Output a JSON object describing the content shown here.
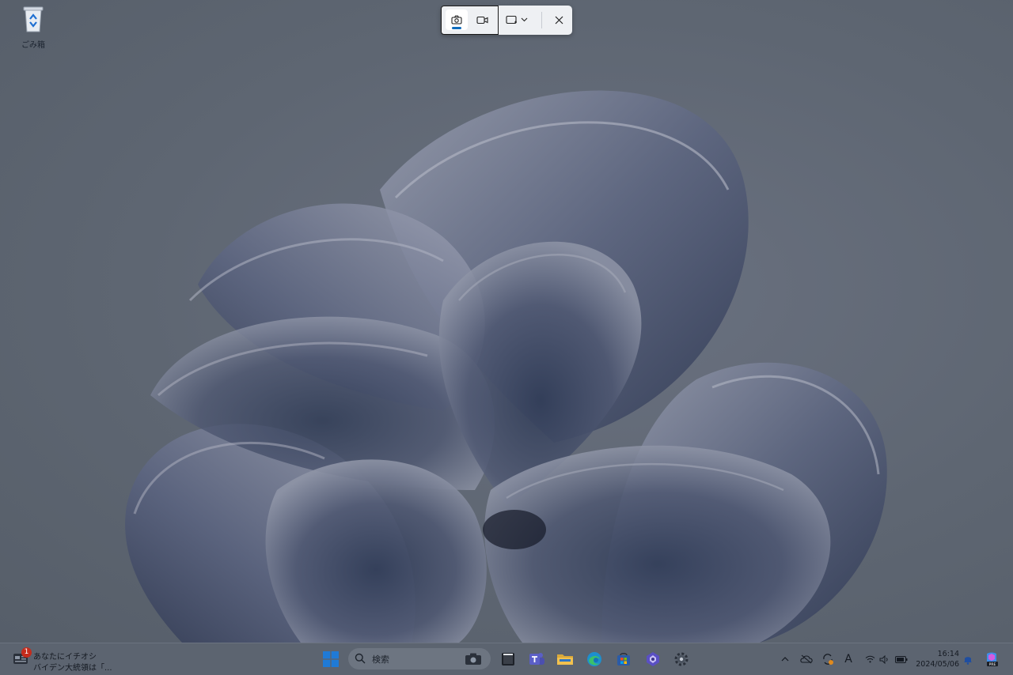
{
  "desktop": {
    "icons": [
      {
        "label": "ごみ箱",
        "icon": "recycle-bin-icon"
      }
    ]
  },
  "snipping_toolbar": {
    "buttons": [
      {
        "name": "screenshot-mode",
        "icon": "camera-icon",
        "selected": true
      },
      {
        "name": "record-mode",
        "icon": "video-camera-icon",
        "selected": false
      },
      {
        "name": "snip-shape",
        "icon": "rectangle-snip-icon",
        "has_dropdown": true
      },
      {
        "name": "close",
        "icon": "close-icon"
      }
    ],
    "accent": "#0f6cbd"
  },
  "taskbar": {
    "widget": {
      "badge": "1",
      "title": "あなたにイチオシ",
      "subtitle": "バイデン大統領は「..."
    },
    "search": {
      "placeholder": "検索"
    },
    "apps": [
      {
        "name": "start",
        "icon": "windows-logo-icon"
      },
      {
        "name": "terminal",
        "icon": "terminal-icon"
      },
      {
        "name": "teams",
        "icon": "teams-icon"
      },
      {
        "name": "file-explorer",
        "icon": "folder-icon"
      },
      {
        "name": "edge",
        "icon": "edge-browser-icon"
      },
      {
        "name": "store",
        "icon": "store-icon"
      },
      {
        "name": "copilot",
        "icon": "copilot-icon"
      },
      {
        "name": "settings",
        "icon": "gear-icon"
      }
    ],
    "tray": {
      "icons": [
        "chevron-up-icon",
        "onedrive-icon",
        "sync-icon",
        "ime-icon",
        "wifi-icon",
        "speaker-icon",
        "battery-icon"
      ],
      "ime_label": "A",
      "time": "16:14",
      "date": "2024/05/06",
      "notification_icon": "bell-icon",
      "copilot_badge": "PRE"
    }
  }
}
